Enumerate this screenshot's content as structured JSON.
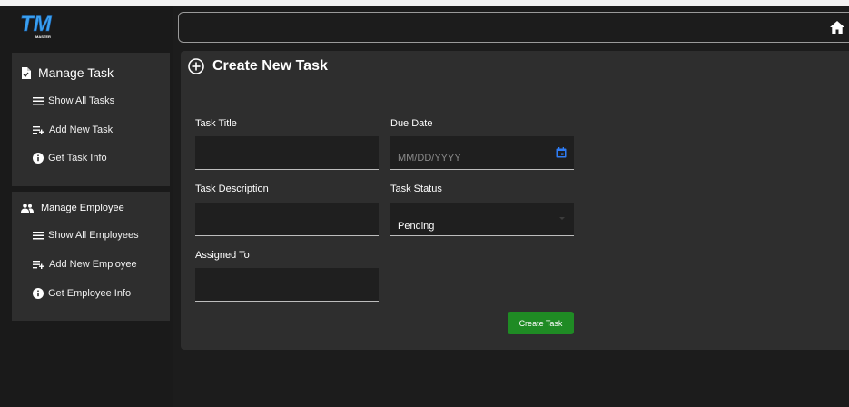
{
  "app": {
    "logo_text": "TM",
    "logo_subtext": "MASTER"
  },
  "sidebar": {
    "task_section": {
      "title": "Manage Task",
      "items": [
        {
          "label": "Show All Tasks",
          "icon": "list-icon"
        },
        {
          "label": "Add New Task",
          "icon": "playlist-add-icon"
        },
        {
          "label": "Get Task Info",
          "icon": "info-icon"
        }
      ]
    },
    "employee_section": {
      "title": "Manage Employee",
      "items": [
        {
          "label": "Show All Employees",
          "icon": "list-icon"
        },
        {
          "label": "Add New Employee",
          "icon": "playlist-add-icon"
        },
        {
          "label": "Get Employee Info",
          "icon": "info-icon"
        }
      ]
    }
  },
  "header": {
    "icon": "home-icon"
  },
  "form": {
    "title": "Create New Task",
    "task_title_label": "Task Title",
    "task_title_value": "",
    "due_date_label": "Due Date",
    "due_date_placeholder": "MM/DD/YYYY",
    "task_description_label": "Task Description",
    "task_description_value": "",
    "task_status_label": "Task Status",
    "task_status_value": "Pending",
    "assigned_to_label": "Assigned To",
    "assigned_to_value": "",
    "submit_label": "Create Task"
  },
  "colors": {
    "background": "#1c1c1c",
    "panel": "#2e2e2e",
    "input": "#1f1f1f",
    "accent_green": "#1f8b24",
    "calendar_blue": "#2f7df6",
    "logo_blue": "#3aa0f0"
  }
}
